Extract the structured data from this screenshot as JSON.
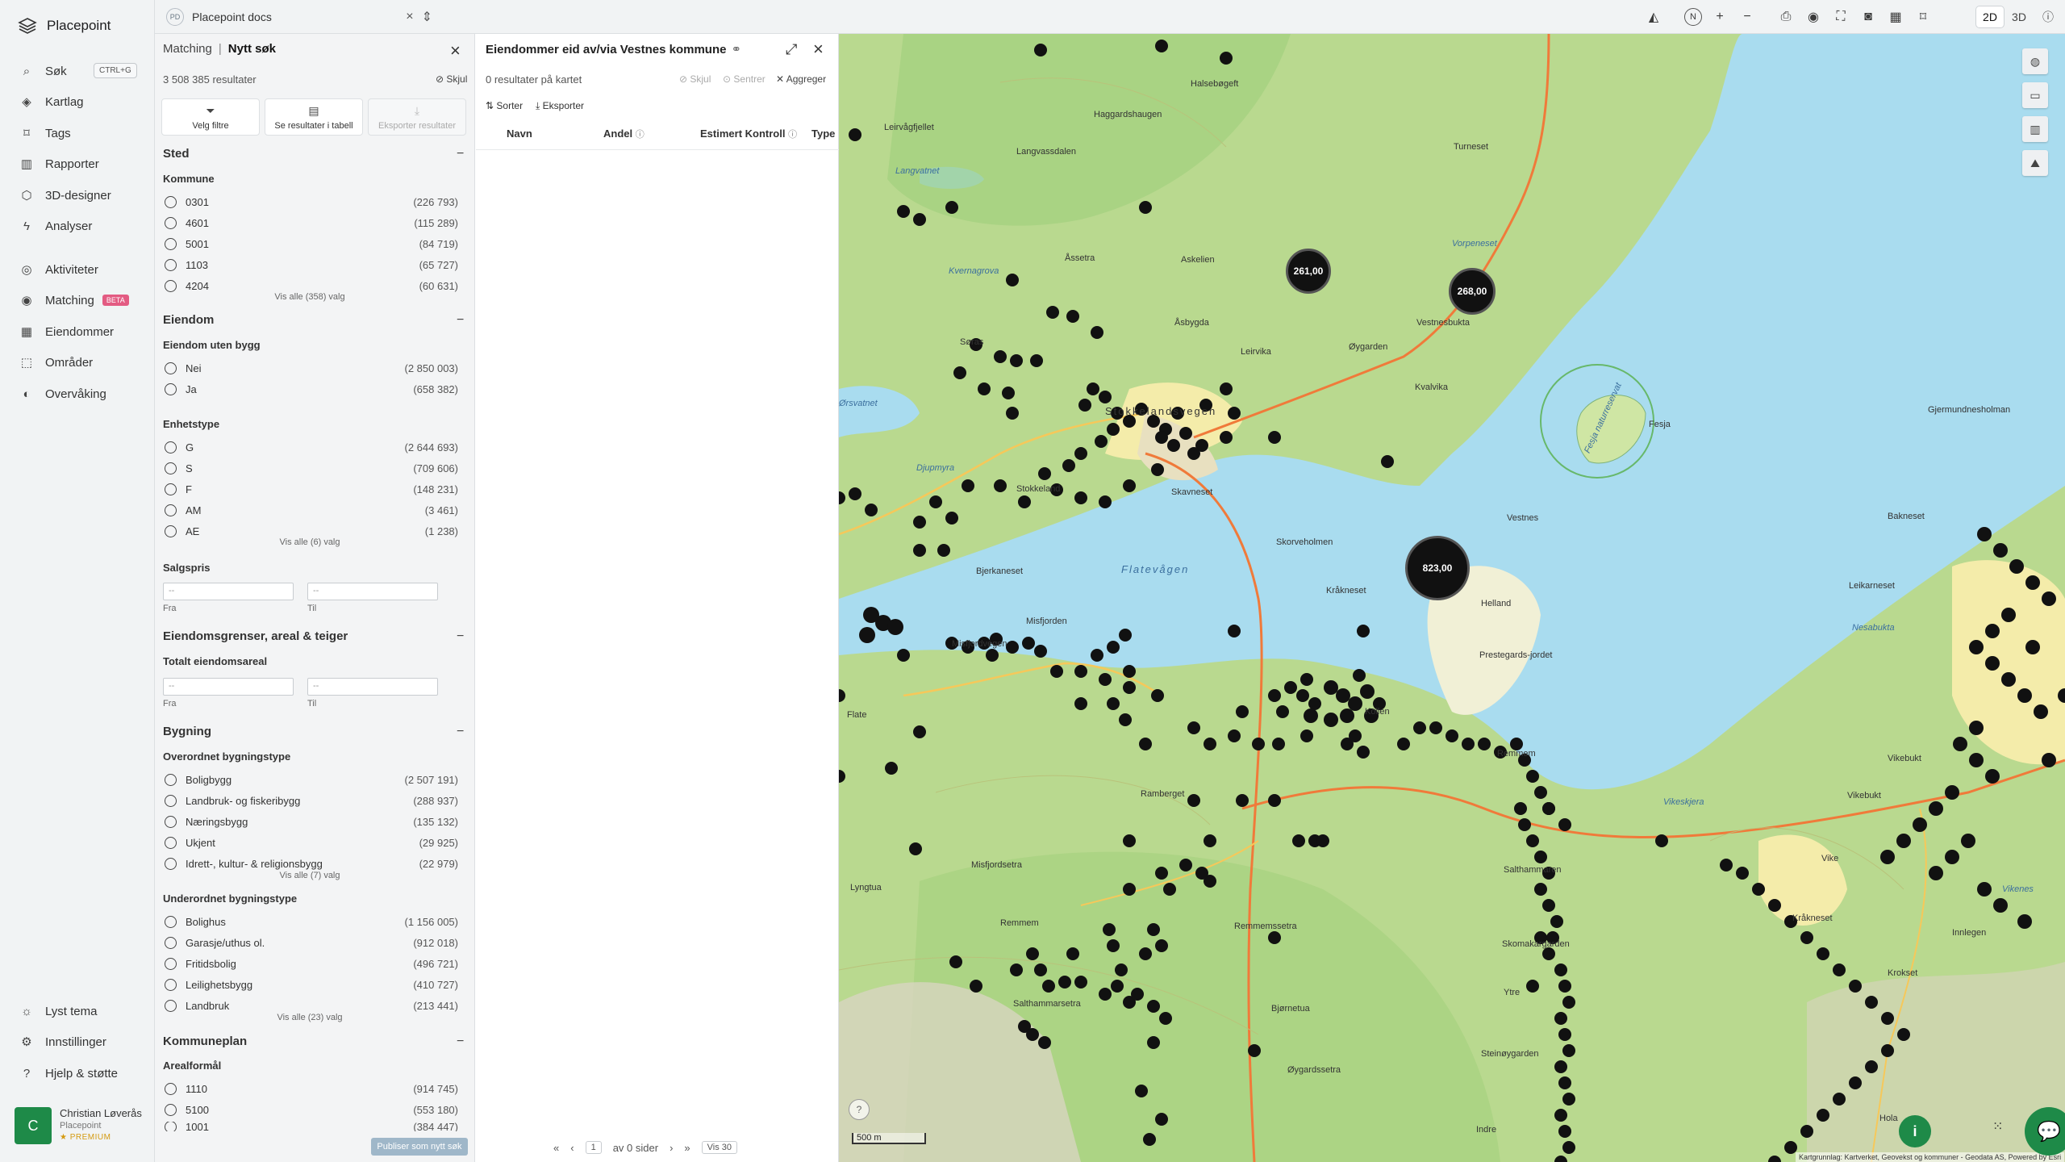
{
  "app": {
    "brand": "Placepoint"
  },
  "nav": {
    "search": "Søk",
    "search_shortcut": "CTRL+G",
    "items": [
      "Kartlag",
      "Tags",
      "Rapporter",
      "3D-designer",
      "Analyser",
      "Aktiviteter",
      "Matching",
      "Eiendommer",
      "Områder",
      "Overvåking"
    ],
    "beta_badge": "BETA",
    "bottom": [
      "Lyst tema",
      "Innstillinger",
      "Hjelp & støtte"
    ],
    "user": {
      "initial": "C",
      "name": "Christian Løverås",
      "org": "Placepoint",
      "plan": "PREMIUM"
    }
  },
  "topbar": {
    "doc_badge": "PD",
    "doc_title": "Placepoint docs",
    "compass": "N",
    "view_2d": "2D",
    "view_3d": "3D"
  },
  "filters": {
    "crumb": "Matching",
    "current": "Nytt søk",
    "count": "3 508 385 resultater",
    "hide": "Skjul",
    "buttons": [
      "Velg filtre",
      "Se resultater i tabell",
      "Eksporter resultater"
    ],
    "sted": {
      "title": "Sted",
      "group": "Kommune",
      "options": [
        {
          "label": "0301",
          "count": "(226 793)"
        },
        {
          "label": "4601",
          "count": "(115 289)"
        },
        {
          "label": "5001",
          "count": "(84 719)"
        },
        {
          "label": "1103",
          "count": "(65 727)"
        },
        {
          "label": "4204",
          "count": "(60 631)"
        }
      ],
      "show_all": "Vis alle (358) valg"
    },
    "eiendom": {
      "title": "Eiendom",
      "g1": "Eiendom uten bygg",
      "g1_options": [
        {
          "label": "Nei",
          "count": "(2 850 003)"
        },
        {
          "label": "Ja",
          "count": "(658 382)"
        }
      ],
      "g2": "Enhetstype",
      "g2_options": [
        {
          "label": "G",
          "count": "(2 644 693)"
        },
        {
          "label": "S",
          "count": "(709 606)"
        },
        {
          "label": "F",
          "count": "(148 231)"
        },
        {
          "label": "AM",
          "count": "(3 461)"
        },
        {
          "label": "AE",
          "count": "(1 238)"
        }
      ],
      "g2_show_all": "Vis alle (6) valg",
      "g3": "Salgspris",
      "from_ph": "--",
      "to_ph": "--",
      "from_lbl": "Fra",
      "to_lbl": "Til"
    },
    "grenser": {
      "title": "Eiendomsgrenser, areal & teiger",
      "group": "Totalt eiendomsareal",
      "from_ph": "--",
      "to_ph": "--",
      "from_lbl": "Fra",
      "to_lbl": "Til"
    },
    "bygning": {
      "title": "Bygning",
      "g1": "Overordnet bygningstype",
      "g1_options": [
        {
          "label": "Boligbygg",
          "count": "(2 507 191)"
        },
        {
          "label": "Landbruk- og fiskeribygg",
          "count": "(288 937)"
        },
        {
          "label": "Næringsbygg",
          "count": "(135 132)"
        },
        {
          "label": "Ukjent",
          "count": "(29 925)"
        },
        {
          "label": "Idrett-, kultur- & religionsbygg",
          "count": "(22 979)"
        }
      ],
      "g1_show_all": "Vis alle (7) valg",
      "g2": "Underordnet bygningstype",
      "g2_options": [
        {
          "label": "Bolighus",
          "count": "(1 156 005)"
        },
        {
          "label": "Garasje/uthus ol.",
          "count": "(912 018)"
        },
        {
          "label": "Fritidsbolig",
          "count": "(496 721)"
        },
        {
          "label": "Leilighetsbygg",
          "count": "(410 727)"
        },
        {
          "label": "Landbruk",
          "count": "(213 441)"
        }
      ],
      "g2_show_all": "Vis alle (23) valg"
    },
    "kommuneplan": {
      "title": "Kommuneplan",
      "group": "Arealformål",
      "options": [
        {
          "label": "1110",
          "count": "(914 745)"
        },
        {
          "label": "5100",
          "count": "(553 180)"
        },
        {
          "label": "1001",
          "count": "(384 447)"
        }
      ]
    },
    "publish": "Publiser som nytt søk"
  },
  "results": {
    "title": "Eiendommer eid av/via Vestnes kommune",
    "count": "0 resultater på kartet",
    "actions": [
      "Skjul",
      "Sentrer",
      "Aggreger"
    ],
    "tools": [
      "Sorter",
      "Eksporter"
    ],
    "columns": [
      "Navn",
      "Andel",
      "Estimert Kontroll",
      "Type"
    ],
    "pager": {
      "page": "1",
      "of": "av 0 sider",
      "per_page": "Vis 30"
    }
  },
  "map": {
    "clusters": [
      "261,00",
      "268,00",
      "823,00"
    ],
    "labels": [
      "Halsebøgeft",
      "Haggardshaugen",
      "Leirvågfjellet",
      "Langvassdalen",
      "Langvatnet",
      "Turneset",
      "Vorpeneset",
      "Åssetra",
      "Askelien",
      "Kvernagrova",
      "Vestnesbukta",
      "Åsbygda",
      "Leirvika",
      "Øygarden",
      "Kvalvika",
      "Fesja",
      "Gjermundnesholman",
      "Søras",
      "Stokkelandsvegen",
      "Skavneset",
      "Djupmyra",
      "Vestnes",
      "Stokkeland",
      "Flatevågen",
      "Skorveholmen",
      "Bjerkaneset",
      "Kråkneset",
      "Helland",
      "Bakneset",
      "Leikarneset",
      "Nesabukta",
      "Misfjorden",
      "Misfjordvegen",
      "Prestegards-jordet",
      "Kollen",
      "Flate",
      "Remmem",
      "Vikebukt",
      "Vikeskjera",
      "Ramberget",
      "Misfjordsetra",
      "Salthammaren",
      "Lyngtua",
      "Remmemssetra",
      "Skomakargarden",
      "Kråkneset",
      "Innlegen",
      "Remmem",
      "Ytre",
      "Bjørnetua",
      "Krokset",
      "Salthammarsetra",
      "Øygardssetra",
      "Steinøygarden",
      "Indre",
      "Hola",
      "Ørsvatnet",
      "Fesja naturreservat",
      "Vike",
      "Vikebukt",
      "Vikenes"
    ],
    "scale": "500 m",
    "attribution": "Kartgrunnlag: Kartverket, Geovekst og kommuner - Geodata AS, Powered by Esri"
  }
}
